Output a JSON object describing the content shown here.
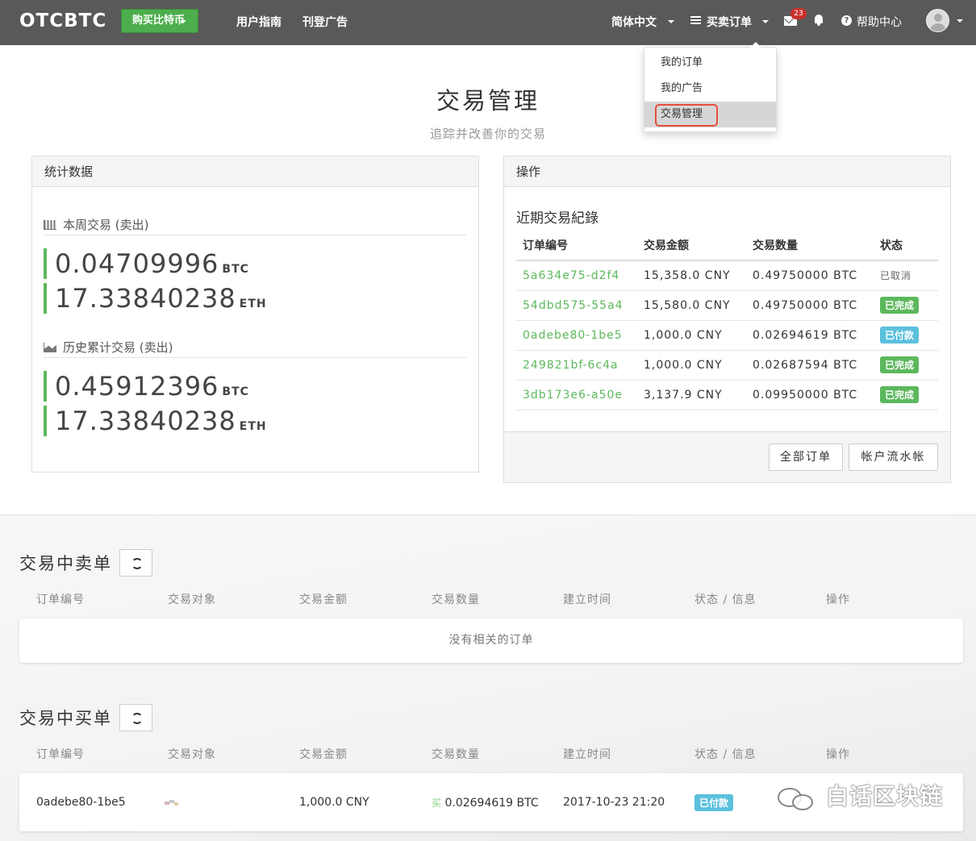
{
  "nav": {
    "logo": "OTCBTC",
    "buy_button": "购买比特币",
    "links": [
      "用户指南",
      "刊登广告"
    ],
    "language": "简体中文",
    "orders_menu": "买卖订单",
    "mail_badge": "23",
    "help": "帮助中心",
    "help_icon": "?"
  },
  "dropdown": {
    "items": [
      "我的订单",
      "我的广告",
      "交易管理"
    ],
    "active": "交易管理"
  },
  "header": {
    "title": "交易管理",
    "subtitle": "追踪并改善你的交易"
  },
  "stats": {
    "panel_title": "统计数据",
    "week": {
      "label": "本周交易 (卖出)",
      "btc": "0.04709996",
      "btc_unit": "BTC",
      "eth": "17.33840238",
      "eth_unit": "ETH"
    },
    "history": {
      "label": "历史累计交易 (卖出)",
      "btc": "0.45912396",
      "btc_unit": "BTC",
      "eth": "17.33840238",
      "eth_unit": "ETH"
    }
  },
  "operations": {
    "panel_title": "操作",
    "recent_title": "近期交易紀錄",
    "columns": [
      "订单编号",
      "交易金额",
      "交易数量",
      "状态"
    ],
    "rows": [
      {
        "id": "5a634e75-d2f4",
        "amount": "15,358.0 CNY",
        "qty": "0.49750000 BTC",
        "status": "已取消",
        "style": "plain"
      },
      {
        "id": "54dbd575-55a4",
        "amount": "15,580.0 CNY",
        "qty": "0.49750000 BTC",
        "status": "已完成",
        "style": "green"
      },
      {
        "id": "0adebe80-1be5",
        "amount": "1,000.0 CNY",
        "qty": "0.02694619 BTC",
        "status": "已付款",
        "style": "blue"
      },
      {
        "id": "249821bf-6c4a",
        "amount": "1,000.0 CNY",
        "qty": "0.02687594 BTC",
        "status": "已完成",
        "style": "green"
      },
      {
        "id": "3db173e6-a50e",
        "amount": "3,137.9 CNY",
        "qty": "0.09950000 BTC",
        "status": "已完成",
        "style": "green"
      }
    ],
    "btn_all_orders": "全部订单",
    "btn_account_flow": "帐户流水帐"
  },
  "sell_section": {
    "title": "交易中卖单",
    "columns": [
      "订单编号",
      "交易对象",
      "交易金额",
      "交易数量",
      "建立时间",
      "状态 / 信息",
      "操作"
    ],
    "empty": "没有相关的订单"
  },
  "buy_section": {
    "title": "交易中买单",
    "columns": [
      "订单编号",
      "交易对象",
      "交易金额",
      "交易数量",
      "建立时间",
      "状态 / 信息",
      "操作"
    ],
    "row": {
      "id": "0adebe80-1be5",
      "amount": "1,000.0 CNY",
      "qty_tag": "买",
      "qty": "0.02694619 BTC",
      "time": "2017-10-23 21:20",
      "status": "已付款"
    }
  },
  "watermark": "白话区块链",
  "colors": {
    "nav_bg": "#595959",
    "green": "#5cb85c",
    "blue": "#5bc0de",
    "highlight": "#e84c3d"
  }
}
